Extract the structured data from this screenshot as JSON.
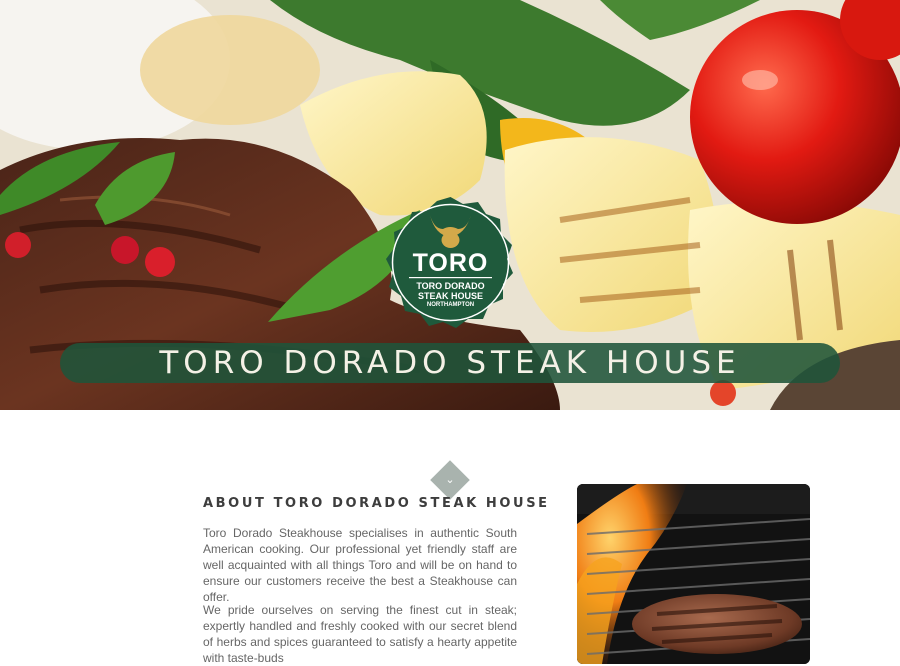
{
  "hero": {
    "title": "TORO DORADO STEAK HOUSE",
    "logo": {
      "main": "TORO",
      "line1": "TORO DORADO",
      "line2": "STEAK HOUSE",
      "line3": "NORTHAMPTON"
    }
  },
  "about": {
    "heading": "ABOUT TORO DORADO STEAK HOUSE",
    "paragraph1": "Toro Dorado Steakhouse specialises in authentic South American cooking. Our professional yet friendly staff are well acquainted with all things Toro and will be on hand to ensure our customers receive the best a Steakhouse can offer.",
    "paragraph2": "We pride ourselves on serving the finest cut in steak; expertly handled and freshly cooked with our secret blend of herbs and spices guaranteed to satisfy a hearty appetite with taste-buds"
  },
  "icons": {
    "scroll_down": "chevron-down-icon"
  },
  "colors": {
    "brand_green": "#1f543a",
    "banner_text": "#f4f1e6",
    "heading": "#3d3d3d",
    "body_text": "#666666",
    "divider_diamond": "#a9b3ae"
  }
}
